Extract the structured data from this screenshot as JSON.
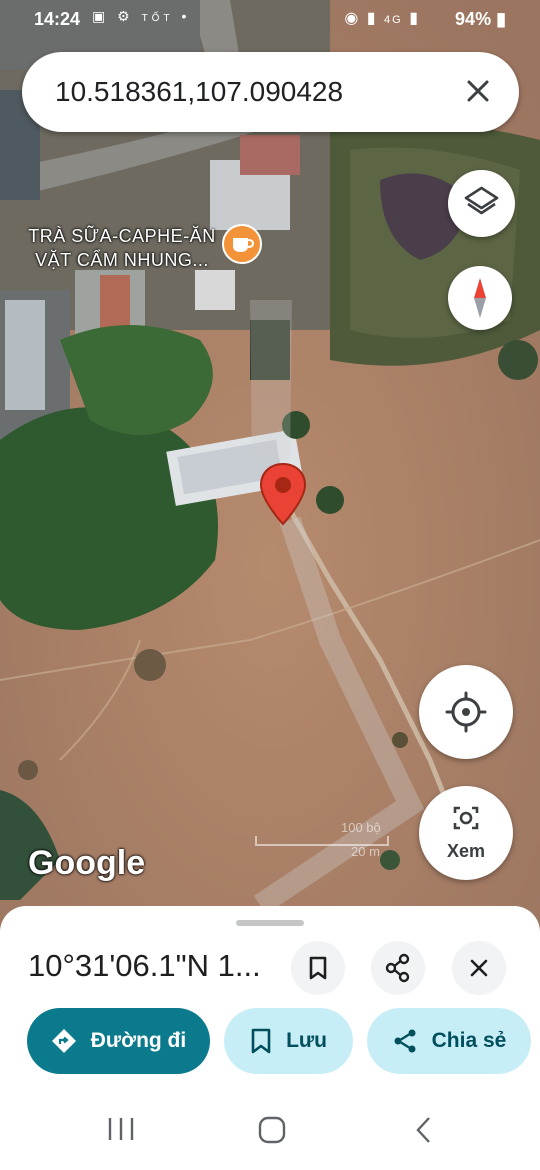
{
  "status_bar": {
    "time": "14:24",
    "carrier_badge": "TỐT",
    "network": "4G",
    "battery": "94%"
  },
  "search": {
    "query": "10.518361,107.090428",
    "clear_icon": "close-icon"
  },
  "map": {
    "poi_label": "TRÀ SỮA-CAPHE-ĂN VẶT CẨM NHUNG...",
    "poi_icon": "coffee-cup-icon",
    "watermark": "Google",
    "scale_top": "100 bộ",
    "scale_bottom": "20 m",
    "pin_color": "#ea4335",
    "poi_color": "#f29339"
  },
  "controls": {
    "layers_icon": "layers-icon",
    "compass_icon": "compass-icon",
    "my_location_icon": "my-location-icon",
    "lens_icon": "camera-lens-icon",
    "lens_label": "Xem"
  },
  "sheet": {
    "title": "10°31'06.1\"N 1...",
    "actions": {
      "directions": "Đường đi",
      "save": "Lưu",
      "share": "Chia sẻ"
    },
    "colors": {
      "primary": "#0b7a8c",
      "tonal": "#c7eef7",
      "tonal_text": "#004f5c"
    }
  },
  "system_nav": {
    "recent": "recent-apps-icon",
    "home": "home-icon",
    "back": "back-icon"
  }
}
